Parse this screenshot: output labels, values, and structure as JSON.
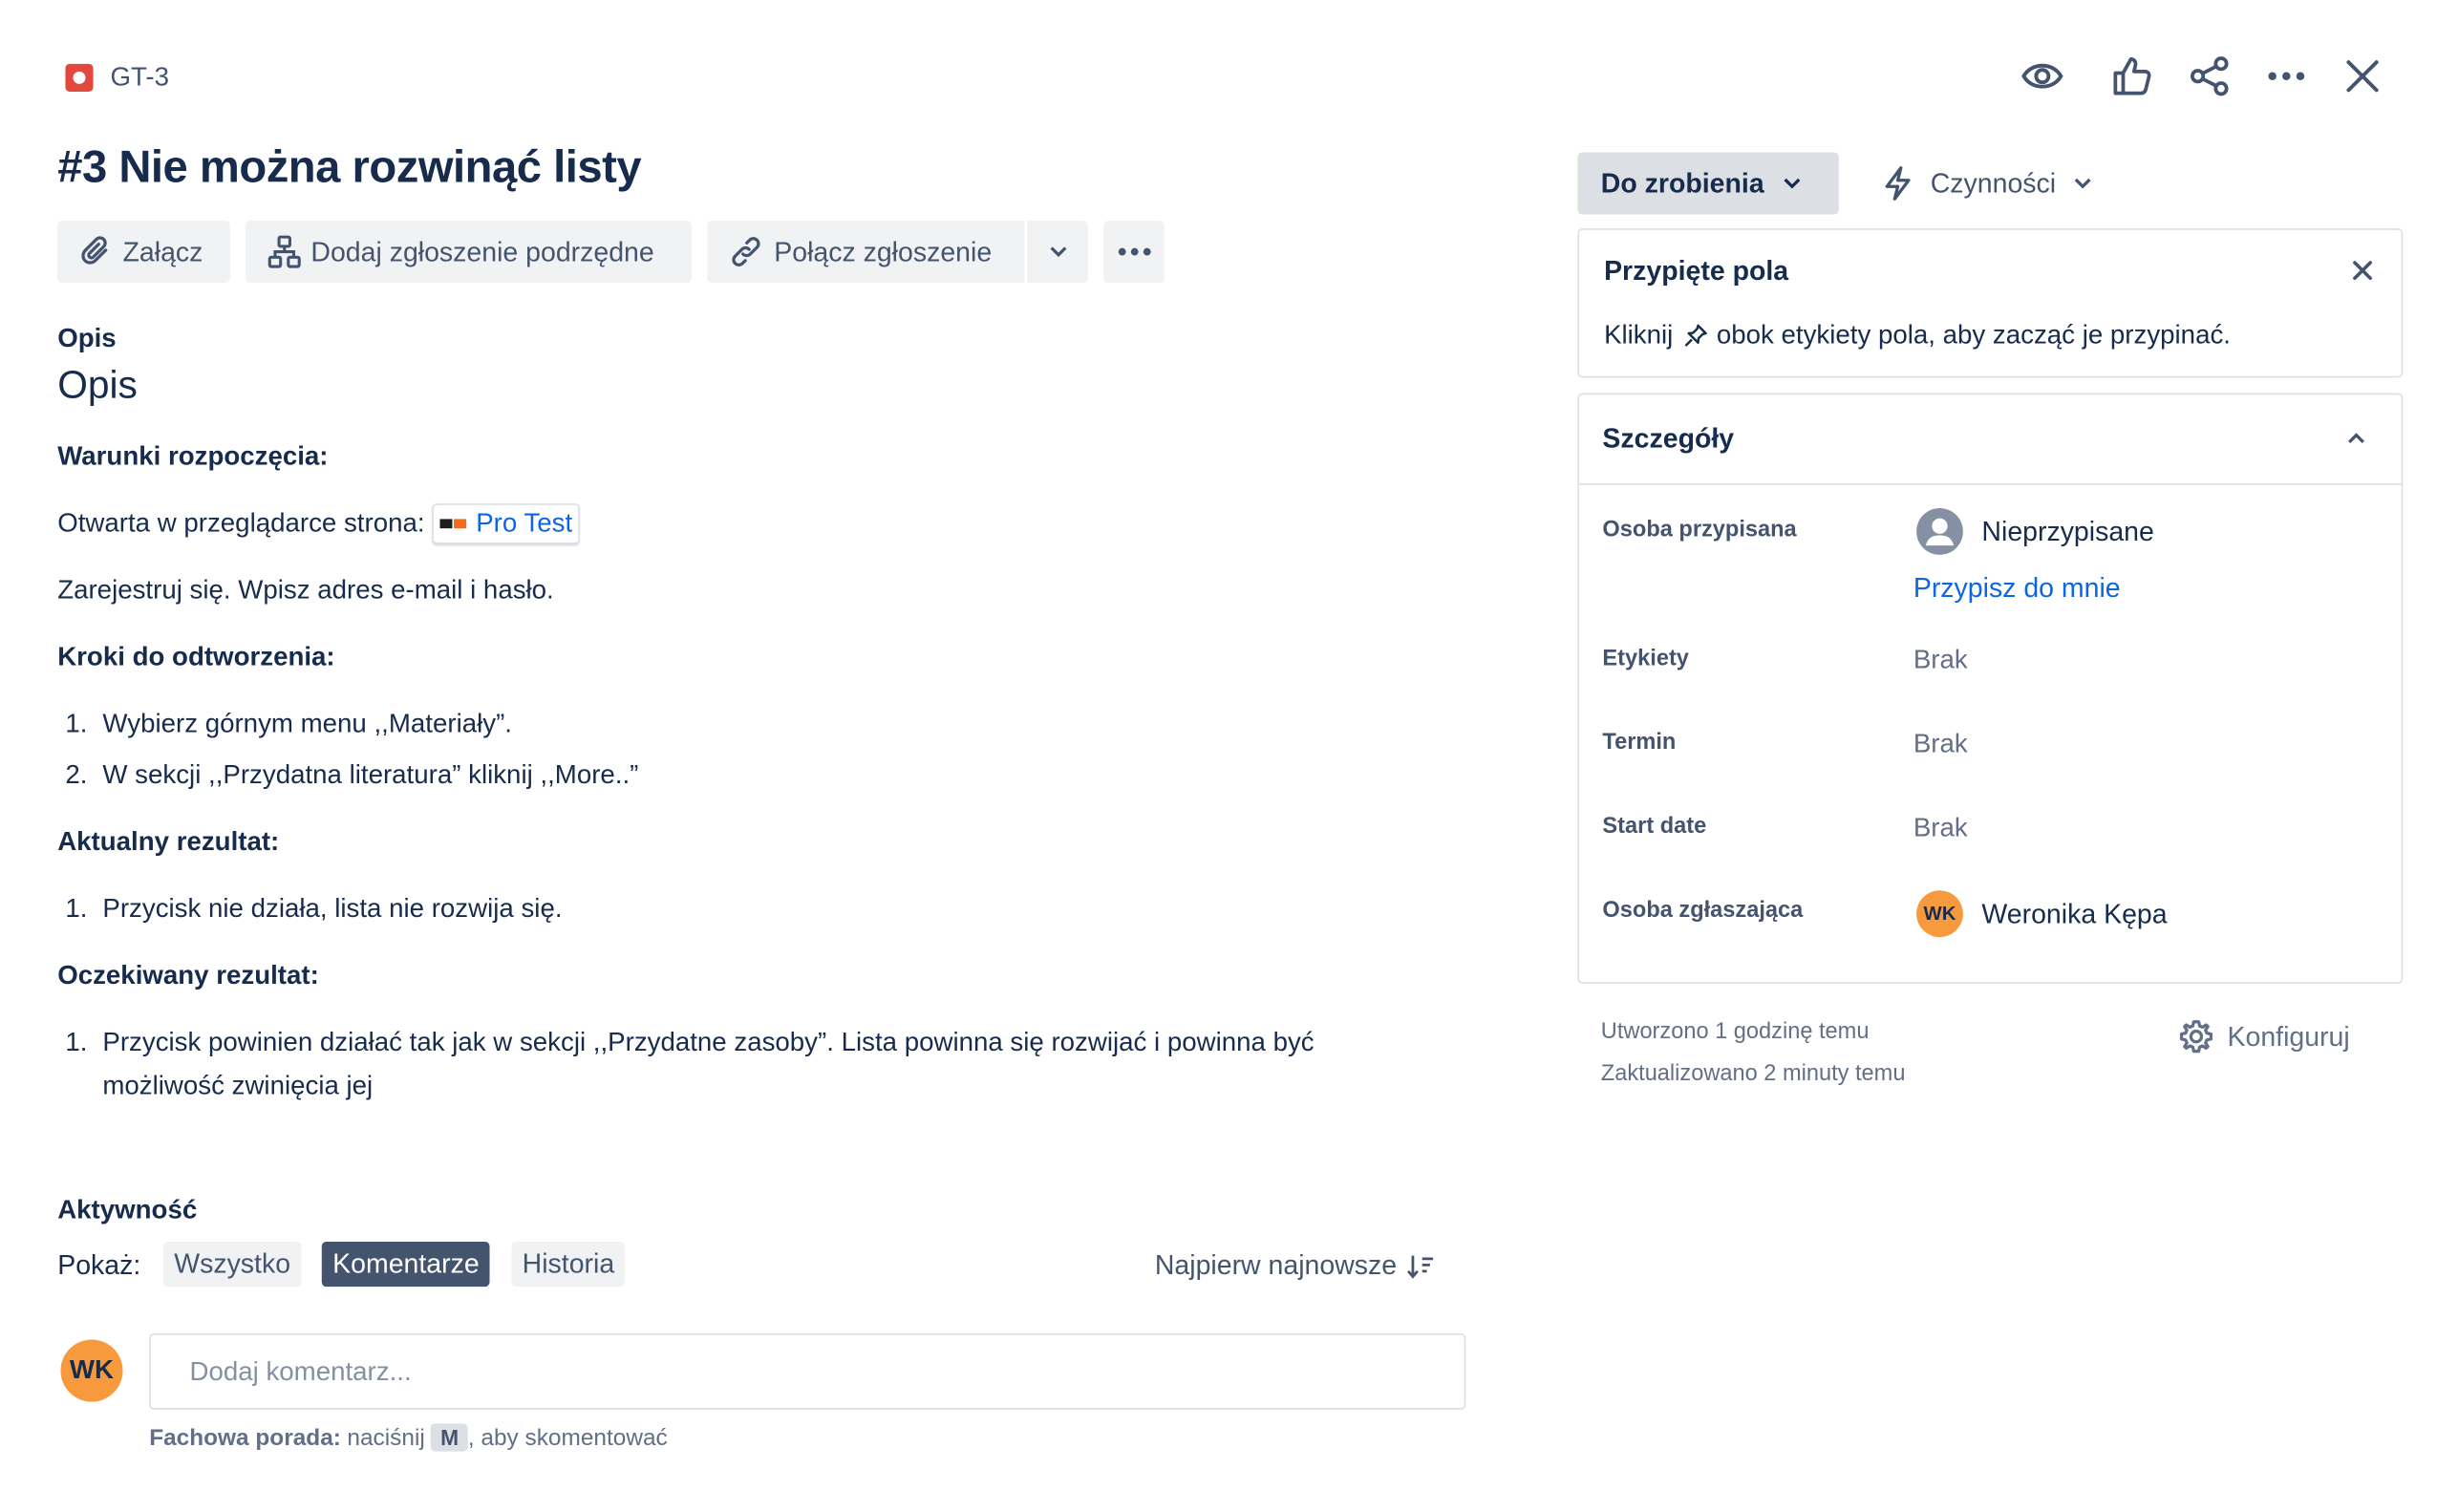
{
  "issue": {
    "key": "GT-3",
    "title": "#3 Nie można rozwinąć listy"
  },
  "toolbar": {
    "attach": "Załącz",
    "add_child": "Dodaj zgłoszenie podrzędne",
    "link_issue": "Połącz zgłoszenie"
  },
  "description": {
    "section_label": "Opis",
    "heading": "Opis",
    "preconditions_heading": "Warunki rozpoczęcia:",
    "opened_page_text": "Otwarta w przeglądarce strona:",
    "smart_link": "Pro Test",
    "register_text": "Zarejestruj się. Wpisz adres e-mail i hasło.",
    "steps_heading": "Kroki do odtworzenia:",
    "steps": [
      {
        "num": "1.",
        "text": "Wybierz górnym menu ,,Materiały”."
      },
      {
        "num": "2.",
        "text": "W sekcji ,,Przydatna literatura” kliknij ,,More..”"
      }
    ],
    "actual_heading": "Aktualny rezultat:",
    "actual": [
      {
        "num": "1.",
        "text": "Przycisk nie działa, lista nie rozwija się."
      }
    ],
    "expected_heading": "Oczekiwany rezultat:",
    "expected": [
      {
        "num": "1.",
        "line1": "Przycisk powinien działać tak jak w sekcji ,,Przydatne zasoby”. Lista powinna się rozwijać i powinna być",
        "line2": "możliwość zwinięcia jej"
      }
    ]
  },
  "activity": {
    "heading": "Aktywność",
    "show_label": "Pokaż:",
    "filters": [
      "Wszystko",
      "Komentarze",
      "Historia"
    ],
    "selected_filter": "Komentarze",
    "sort_label": "Najpierw najnowsze",
    "comment_placeholder": "Dodaj komentarz...",
    "tip_bold": "Fachowa porada:",
    "tip_text1": "naciśnij",
    "tip_key": "M",
    "tip_text2": ", aby skomentować",
    "avatar_initials": "WK"
  },
  "sidebar": {
    "status": "Do zrobienia",
    "actions": "Czynności",
    "pinned": {
      "title": "Przypięte pola",
      "text_before": "Kliknij",
      "text_after": "obok etykiety pola, aby zacząć je przypinać."
    },
    "details": {
      "title": "Szczegóły",
      "assignee_label": "Osoba przypisana",
      "assignee_value": "Nieprzypisane",
      "assign_to_me": "Przypisz do mnie",
      "labels_label": "Etykiety",
      "labels_value": "Brak",
      "due_label": "Termin",
      "due_value": "Brak",
      "start_label": "Start date",
      "start_value": "Brak",
      "reporter_label": "Osoba zgłaszająca",
      "reporter_initials": "WK",
      "reporter_name": "Weronika Kępa"
    },
    "created": "Utworzono 1 godzinę temu",
    "updated": "Zaktualizowano 2 minuty temu",
    "configure": "Konfiguruj"
  },
  "colors": {
    "text": "#172B4D",
    "subtle": "#44546F",
    "link": "#0C66E4",
    "button_bg": "#F1F2F4",
    "selected_filter_bg": "#44546F",
    "bug_red": "#E2483D",
    "avatar_orange": "#F79A3E"
  }
}
